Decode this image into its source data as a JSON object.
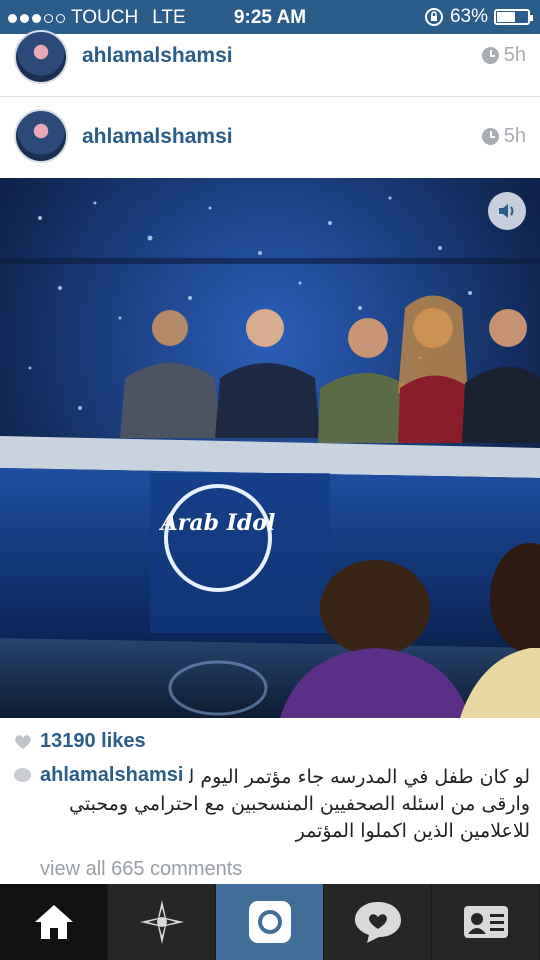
{
  "status_bar": {
    "carrier": "TOUCH",
    "network": "LTE",
    "time": "9:25 AM",
    "battery": "63%",
    "battery_level": 0.63,
    "signal_dots_filled": 3,
    "signal_dots_total": 5
  },
  "posts": [
    {
      "username": "ahlamalshamsi",
      "time": "5h"
    },
    {
      "username": "ahlamalshamsi",
      "time": "5h"
    }
  ],
  "video": {
    "logo_text": "Arab Idol",
    "mute_icon": "speaker-icon"
  },
  "likes": "13190 likes",
  "caption": {
    "username": "ahlamalshamsi",
    "text": "لو كان طفل  في المدرسه جاء مؤتمر اليوم لكان سال افضل وارقى من اسئله الصحفيين المنسحبين مع احترامي ومحبتي للاعلامين الذين اكملوا المؤتمر"
  },
  "view_all": "view all 665 comments",
  "tabs": [
    {
      "name": "home",
      "icon": "home-icon"
    },
    {
      "name": "explore",
      "icon": "star-icon"
    },
    {
      "name": "camera",
      "icon": "camera-icon"
    },
    {
      "name": "news",
      "icon": "speech-heart-icon"
    },
    {
      "name": "profile",
      "icon": "profile-card-icon"
    }
  ],
  "colors": {
    "brand_blue": "#2b5d8a",
    "tab_bar": "#262626",
    "camera_tab": "#3f6e98"
  }
}
